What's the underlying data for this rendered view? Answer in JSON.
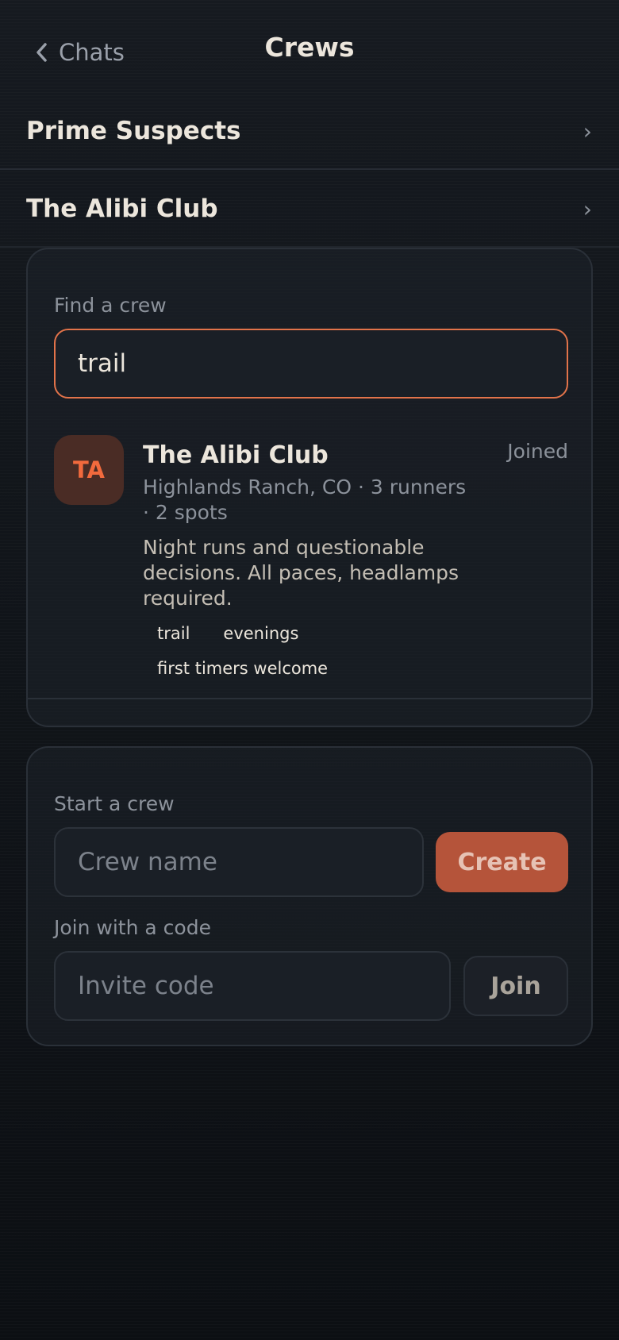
{
  "header": {
    "back_label": "Chats",
    "title": "Crews"
  },
  "crews": [
    {
      "name": "Prime Suspects"
    },
    {
      "name": "The Alibi Club"
    }
  ],
  "find": {
    "label": "Find a crew",
    "query": "trail",
    "result": {
      "initials": "TA",
      "name": "The Alibi Club",
      "status": "Joined",
      "meta": "Highlands Ranch, CO · 3 runners · 2 spots",
      "description": "Night runs and questionable decisions. All paces, headlamps required.",
      "tags": [
        "trail",
        "evenings",
        "first timers welcome"
      ]
    }
  },
  "start": {
    "label": "Start a crew",
    "name_placeholder": "Crew name",
    "create_label": "Create",
    "join_label": "Join with a code",
    "code_placeholder": "Invite code",
    "join_button_label": "Join"
  },
  "colors": {
    "accent": "#e2734a",
    "create_button": "#b5543a",
    "avatar_bg": "#4a2c25",
    "avatar_text": "#f26a3d",
    "background": "#0d1014"
  },
  "icons": {
    "back": "chevron-left-icon",
    "row": "chevron-right-icon"
  }
}
